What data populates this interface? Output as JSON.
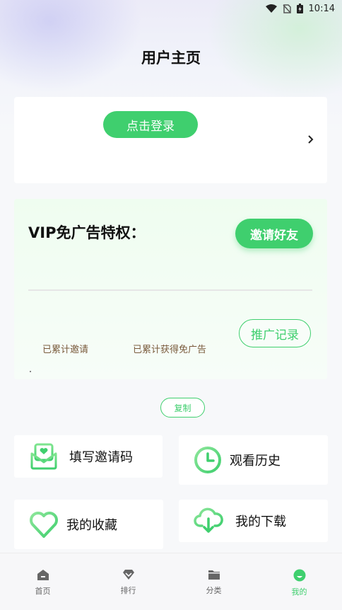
{
  "status_bar": {
    "time": "10:14"
  },
  "page": {
    "title": "用户主页"
  },
  "login": {
    "button_label": "点击登录"
  },
  "vip": {
    "title": "VIP免广告特权：",
    "invite_button": "邀请好友",
    "promo_record_button": "推广记录",
    "stat_invited_label": "已累计邀请",
    "stat_adfree_label": "已累计获得免广告"
  },
  "copy_button": "复制",
  "features": {
    "invite_code": "填写邀请码",
    "history": "观看历史",
    "favorites": "我的收藏",
    "downloads": "我的下载"
  },
  "nav": {
    "items": [
      {
        "label": "首页",
        "icon": "home-icon"
      },
      {
        "label": "排行",
        "icon": "ranking-icon"
      },
      {
        "label": "分类",
        "icon": "folder-icon"
      },
      {
        "label": "我的",
        "icon": "profile-icon"
      }
    ],
    "active": "我的"
  },
  "colors": {
    "accent": "#3fcf6e",
    "stat_text": "#7a5a3c",
    "background": "#f7f8fa"
  }
}
